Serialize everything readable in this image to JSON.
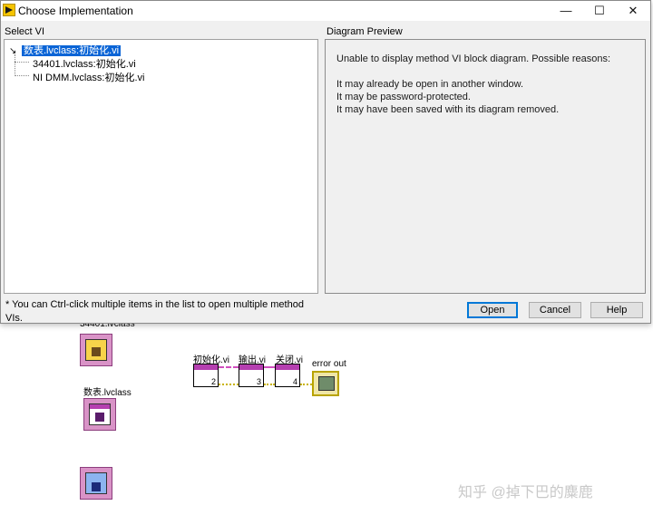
{
  "dialog": {
    "title": "Choose Implementation",
    "controls": {
      "minimize": "—",
      "maximize": "☐",
      "close": "✕"
    },
    "select_vi_label": "Select VI",
    "diagram_preview_label": "Diagram Preview",
    "tree": {
      "root": "数表.lvclass:初始化.vi",
      "children": [
        "34401.lvclass:初始化.vi",
        "NI DMM.lvclass:初始化.vi"
      ]
    },
    "preview_lines": [
      "Unable to display method VI block diagram. Possible reasons:",
      "It may already be open in another window.",
      "It may be password-protected.",
      "It may have been saved with its diagram removed."
    ],
    "footnote": "* You can Ctrl-click multiple items in the list to open multiple method VIs.",
    "buttons": {
      "open": "Open",
      "cancel": "Cancel",
      "help": "Help"
    }
  },
  "diagram": {
    "class_label_top": "34401.lvclass",
    "class_label_mid": "数表.lvclass",
    "nodes": [
      {
        "label": "初始化.vi",
        "num": "2"
      },
      {
        "label": "输出.vi",
        "num": "3"
      },
      {
        "label": "关闭.vi",
        "num": "4"
      }
    ],
    "error_out_label": "error out"
  },
  "watermark": "知乎 @掉下巴的麋鹿"
}
